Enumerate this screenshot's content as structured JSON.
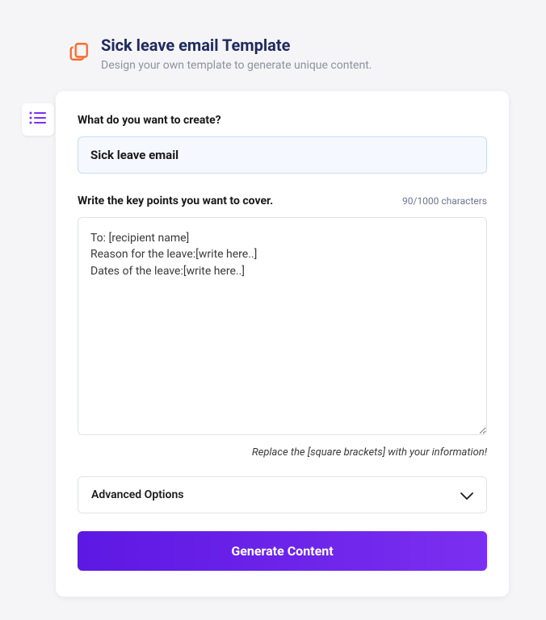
{
  "header": {
    "title": "Sick leave email Template",
    "subtitle": "Design your own template to generate unique content."
  },
  "form": {
    "create_label": "What do you want to create?",
    "create_value": "Sick leave email",
    "keypoints_label": "Write the key points you want to cover.",
    "char_count": "90/1000 characters",
    "keypoints_value": "To: [recipient name]\nReason for the leave:[write here..]\nDates of the leave:[write here..]",
    "helper_text": "Replace the [square brackets] with your information!",
    "advanced_label": "Advanced Options",
    "generate_label": "Generate Content"
  }
}
